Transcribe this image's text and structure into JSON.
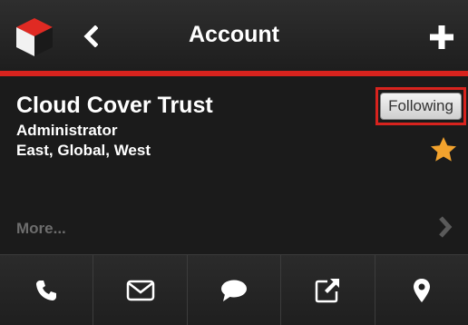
{
  "header": {
    "title": "Account",
    "logo_icon": "cube-logo-icon",
    "back_icon": "chevron-left-icon",
    "add_icon": "plus-icon",
    "accent_color": "#d8231e"
  },
  "account": {
    "name": "Cloud Cover Trust",
    "role": "Administrator",
    "regions": "East, Global, West",
    "follow_label": "Following",
    "favorite_icon": "star-icon",
    "favorite_color": "#f2a22d"
  },
  "more": {
    "label": "More...",
    "chevron_icon": "chevron-right-icon"
  },
  "actions": [
    {
      "icon": "phone-icon"
    },
    {
      "icon": "mail-icon"
    },
    {
      "icon": "chat-icon"
    },
    {
      "icon": "external-link-icon"
    },
    {
      "icon": "map-pin-icon"
    }
  ]
}
